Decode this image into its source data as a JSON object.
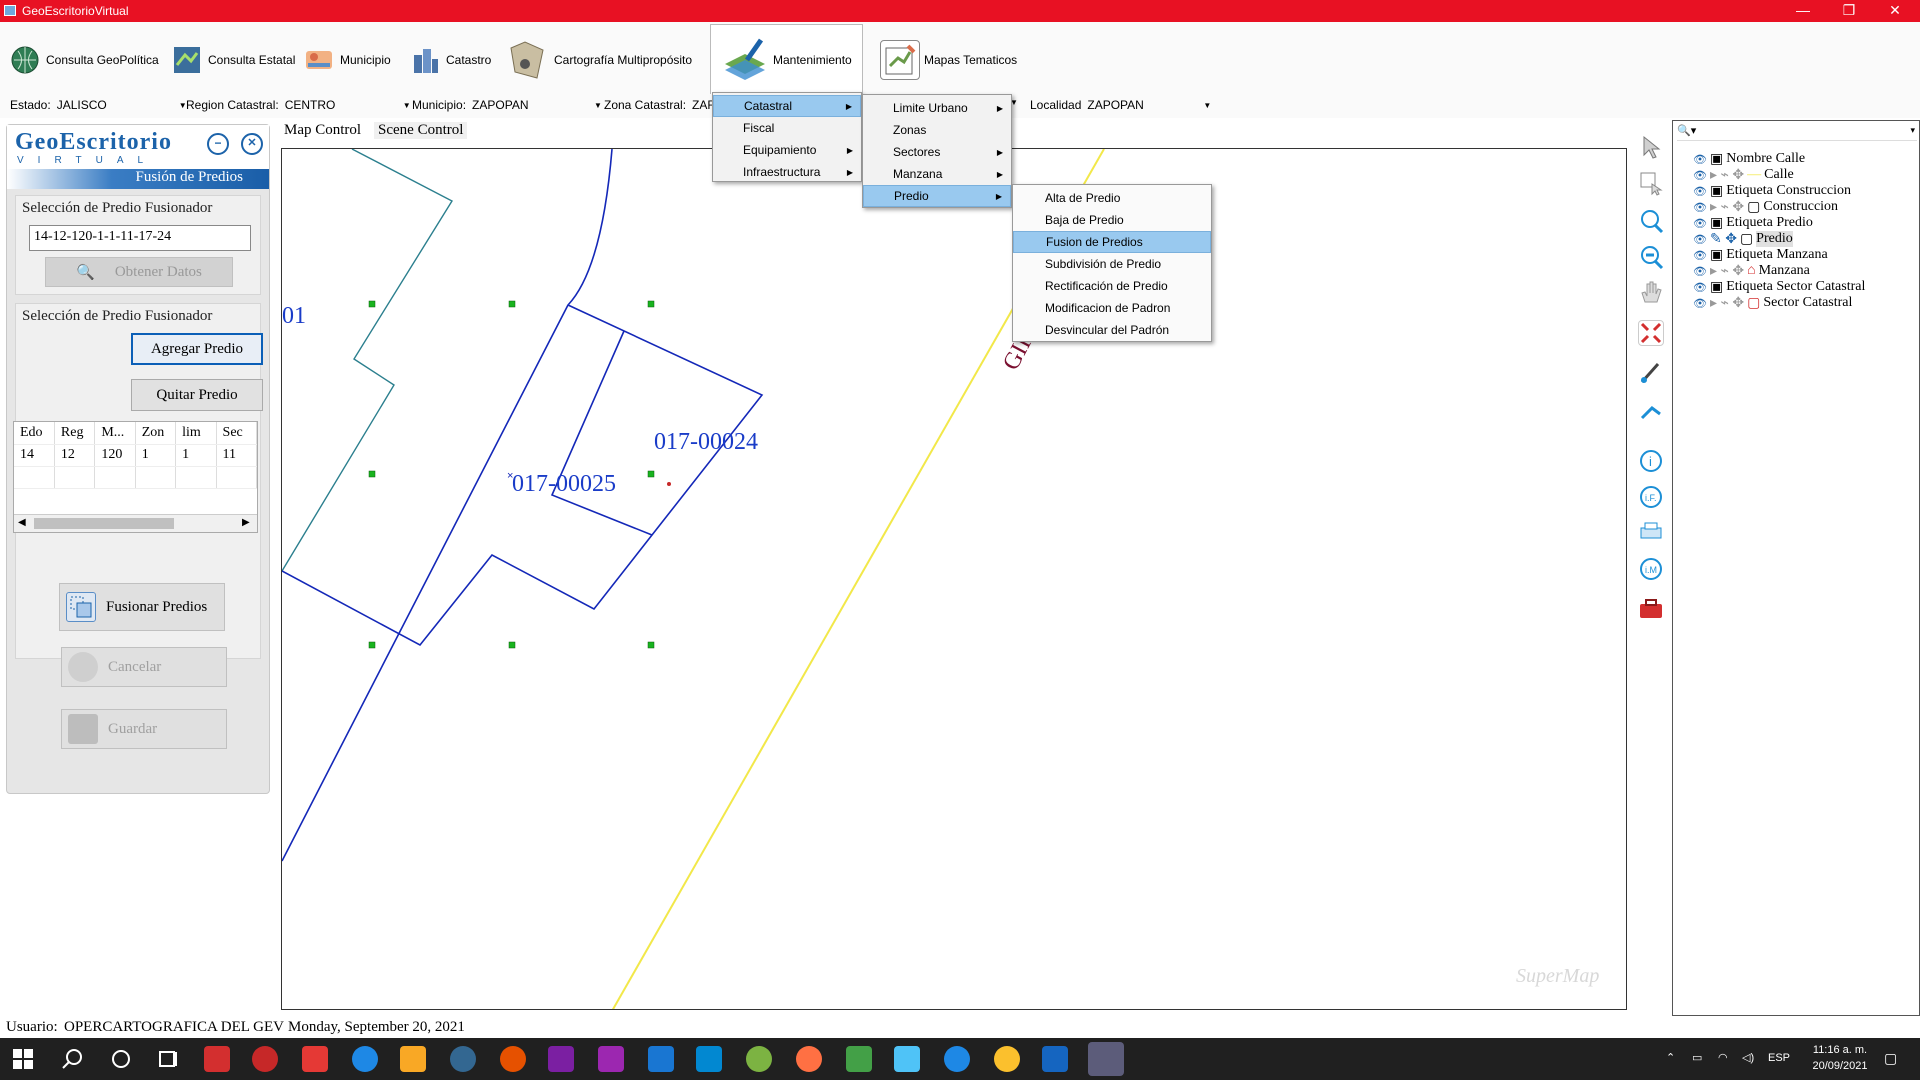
{
  "window": {
    "title": "GeoEscritorioVirtual"
  },
  "ribbon": {
    "items": [
      {
        "label": "Consulta GeoPolítica",
        "icon": "globe-icon",
        "color": "#2f7d54"
      },
      {
        "label": "Consulta Estatal",
        "icon": "state-map-icon",
        "color": "#3b6e9c"
      },
      {
        "label": "Municipio",
        "icon": "municipality-icon",
        "color": "#d96c4a"
      },
      {
        "label": "Catastro",
        "icon": "buildings-icon",
        "color": "#4a73a8"
      },
      {
        "label": "Cartografía Multipropósito",
        "icon": "cartography-icon",
        "color": "#a89876"
      },
      {
        "label": "Mantenimiento",
        "icon": "maintenance-icon",
        "color": "#3c8dd1"
      },
      {
        "label": "Mapas Tematicos",
        "icon": "thematic-map-icon",
        "color": "#6a9a4a"
      }
    ]
  },
  "filters": {
    "estado_label": "Estado:",
    "estado": "JALISCO",
    "region_label": "Region Catastral:",
    "region": "CENTRO",
    "municipio_label": "Municipio:",
    "municipio": "ZAPOPAN",
    "zona_label": "Zona Catastral:",
    "zona": "ZAF",
    "localidad_label": "Localidad",
    "localidad": "ZAPOPAN"
  },
  "left_panel": {
    "logo": "GeoEscritorio",
    "logo_sub": "VIRTUAL",
    "title": "Fusión de Predios",
    "group1_title": "Selección de Predio Fusionador",
    "clave": "14-12-120-1-1-11-17-24",
    "obtener_label": "Obtener Datos",
    "group2_title": "Selección de Predio Fusionador",
    "agregar_label": "Agregar Predio",
    "quitar_label": "Quitar Predio",
    "grid": {
      "headers": [
        "Edo",
        "Reg",
        "M...",
        "Zon",
        "lim",
        "Sec"
      ],
      "rows": [
        [
          "14",
          "12",
          "120",
          "1",
          "1",
          "11"
        ]
      ]
    },
    "fusionar_label": "Fusionar Predios",
    "cancelar_label": "Cancelar",
    "guardar_label": "Guardar"
  },
  "map_tabs": {
    "map": "Map Control",
    "scene": "Scene Control"
  },
  "map": {
    "labels": [
      "017-00024",
      "017-00025",
      "01",
      "GIR"
    ],
    "watermark": "SuperMap"
  },
  "menus": {
    "level1": [
      "Catastral",
      "Fiscal",
      "Equipamiento",
      "Infraestructura"
    ],
    "level2": [
      "Limite Urbano",
      "Zonas",
      "Sectores",
      "Manzana",
      "Predio"
    ],
    "level3": [
      "Alta de Predio",
      "Baja de Predio",
      "Fusion de Predios",
      "Subdivisión de Predio",
      "Rectificación de Predio",
      "Modificacion de Padron",
      "Desvincular del Padrón"
    ]
  },
  "layers": [
    {
      "label": "Nombre Calle",
      "indent": 0
    },
    {
      "label": "Calle",
      "indent": 1
    },
    {
      "label": "Etiqueta Construccion",
      "indent": 0
    },
    {
      "label": "Construccion",
      "indent": 1
    },
    {
      "label": "Etiqueta Predio",
      "indent": 0
    },
    {
      "label": "Predio",
      "indent": 1
    },
    {
      "label": "Etiqueta Manzana",
      "indent": 0
    },
    {
      "label": "Manzana",
      "indent": 1
    },
    {
      "label": "Etiqueta Sector Catastral",
      "indent": 0
    },
    {
      "label": "Sector Catastral",
      "indent": 1
    }
  ],
  "status": {
    "user_label": "Usuario:",
    "user": "OPERCARTOGRAFICA DEL GEV",
    "date": "Monday, September 20, 2021"
  },
  "taskbar": {
    "lang": "ESP",
    "time": "11:16 a. m.",
    "date": "20/09/2021"
  }
}
